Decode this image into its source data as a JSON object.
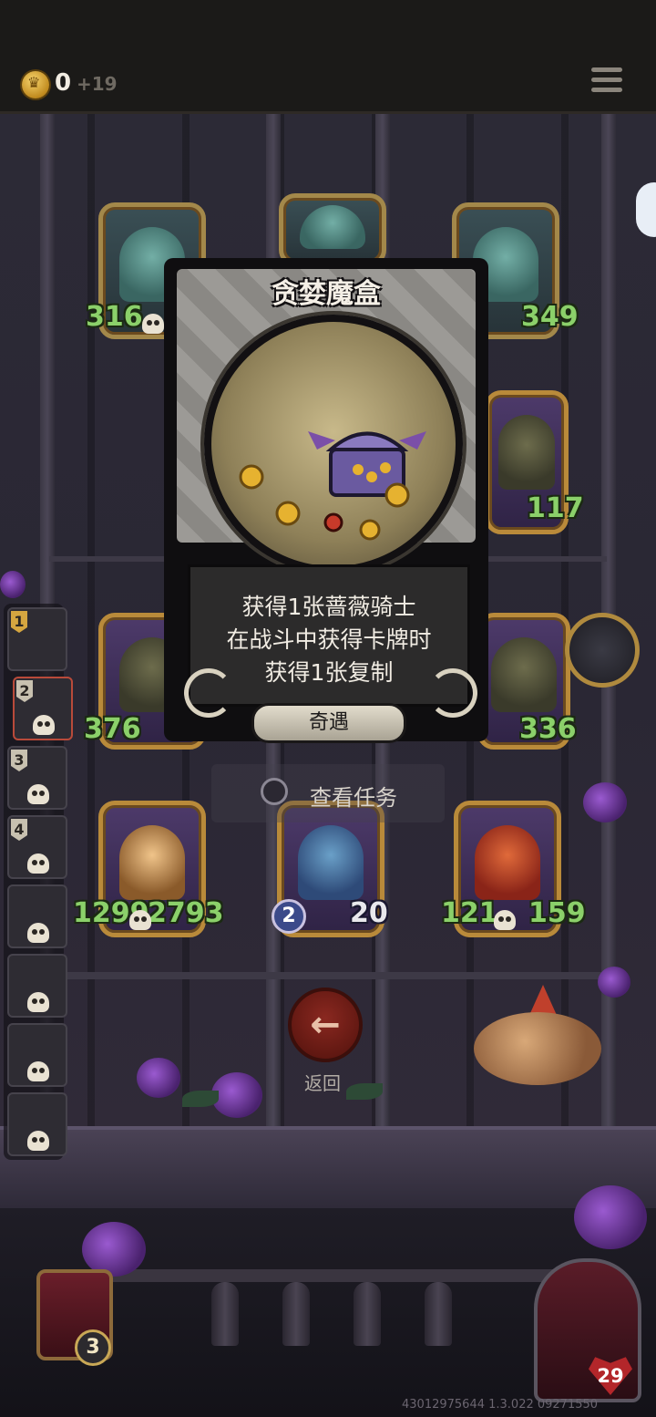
{
  "topbar": {
    "coins": "0",
    "coins_delta": "+19",
    "menu_icon": "hamburger-menu-icon"
  },
  "board_cards": [
    {
      "id": "top-left",
      "left_stat": "316",
      "right_stat": ""
    },
    {
      "id": "top-right",
      "left_stat": "",
      "right_stat": "349"
    },
    {
      "id": "mid-right-upper",
      "left_stat": "",
      "right_stat": "117"
    },
    {
      "id": "mid-left",
      "left_stat": "376",
      "right_stat": ""
    },
    {
      "id": "mid-right",
      "left_stat": "",
      "right_stat": "336"
    },
    {
      "id": "bottom-left",
      "left_stat": "1299",
      "right_stat": "2793"
    },
    {
      "id": "bottom-center",
      "left_stat": "2",
      "right_stat": "20"
    },
    {
      "id": "bottom-right",
      "left_stat": "121",
      "right_stat": "159"
    }
  ],
  "history": [
    {
      "num": "1"
    },
    {
      "num": "2"
    },
    {
      "num": "3"
    },
    {
      "num": "4"
    },
    {
      "num": ""
    },
    {
      "num": ""
    },
    {
      "num": ""
    },
    {
      "num": ""
    }
  ],
  "event": {
    "title": "贪婪魔盒",
    "lines": [
      "获得1张蔷薇骑士",
      "在战斗中获得卡牌时",
      "获得1张复制"
    ],
    "tag": "奇遇"
  },
  "task": {
    "label": "查看任务"
  },
  "back": {
    "label": "返回",
    "icon": "arrow-left-icon"
  },
  "hero_left": {
    "badge": "3"
  },
  "hero_right": {
    "hp": "29"
  },
  "version": "43012975644 1.3.022 09271550"
}
